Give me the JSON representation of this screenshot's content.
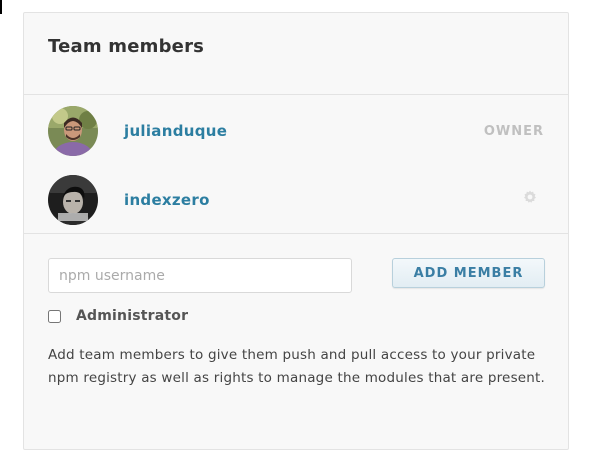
{
  "team_panel": {
    "title": "Team members",
    "members": [
      {
        "username": "julianduque",
        "role": "OWNER",
        "avatar_icon": "julianduque-avatar"
      },
      {
        "username": "indexzero",
        "role": "",
        "avatar_icon": "indexzero-avatar",
        "settings_icon": "gear-icon"
      }
    ],
    "add_member": {
      "username_placeholder": "npm username",
      "username_value": "",
      "button_label": "ADD MEMBER",
      "admin_label": "Administrator",
      "admin_checked": false
    },
    "help_text": "Add team members to give them push and pull access to your private npm registry as well as rights to manage the modules that are present."
  },
  "colors": {
    "link": "#2c7ea1",
    "role": "#c0c0c0",
    "panel_bg": "#f8f8f8",
    "button_text": "#3a7ea4"
  }
}
